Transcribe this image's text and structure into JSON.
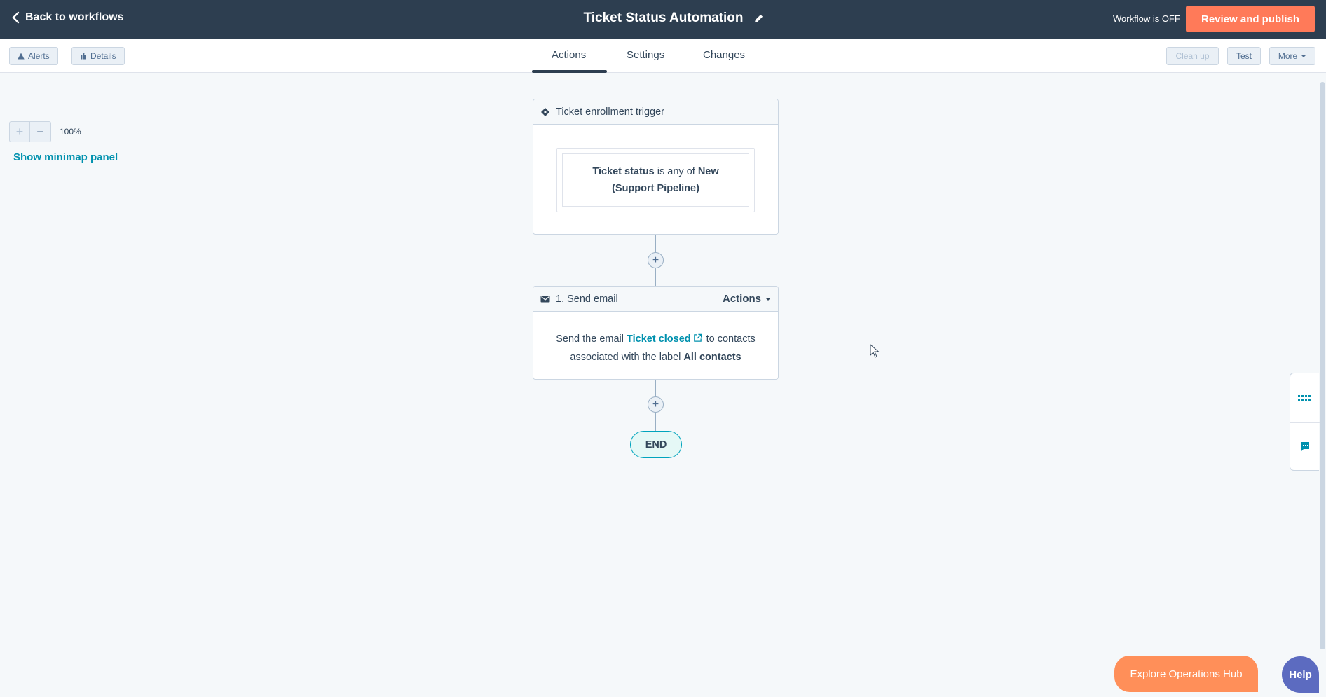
{
  "header": {
    "back_label": "Back to workflows",
    "title": "Ticket Status Automation",
    "workflow_status": "Workflow is OFF",
    "publish_label": "Review and publish"
  },
  "toolbar": {
    "alerts_label": "Alerts",
    "details_label": "Details",
    "tabs": [
      {
        "label": "Actions",
        "active": true
      },
      {
        "label": "Settings",
        "active": false
      },
      {
        "label": "Changes",
        "active": false
      }
    ],
    "cleanup_label": "Clean up",
    "test_label": "Test",
    "more_label": "More"
  },
  "canvas": {
    "zoom_level": "100%",
    "minimap_label": "Show minimap panel",
    "trigger": {
      "title": "Ticket enrollment trigger",
      "property": "Ticket status",
      "operator": "is any of",
      "value_line1": "New",
      "value_line2": "(Support Pipeline)"
    },
    "action": {
      "title": "1. Send email",
      "menu_label": "Actions",
      "text_pre": "Send the email",
      "email_name": "Ticket closed",
      "text_mid": "to contacts associated with the label",
      "label_name": "All contacts"
    },
    "end_label": "END"
  },
  "footer": {
    "explore_label": "Explore Operations Hub",
    "help_label": "Help"
  },
  "colors": {
    "topbar": "#2d3e50",
    "accent_orange": "#ff7a59",
    "link_teal": "#0091ae",
    "end_border": "#00a4bd"
  }
}
